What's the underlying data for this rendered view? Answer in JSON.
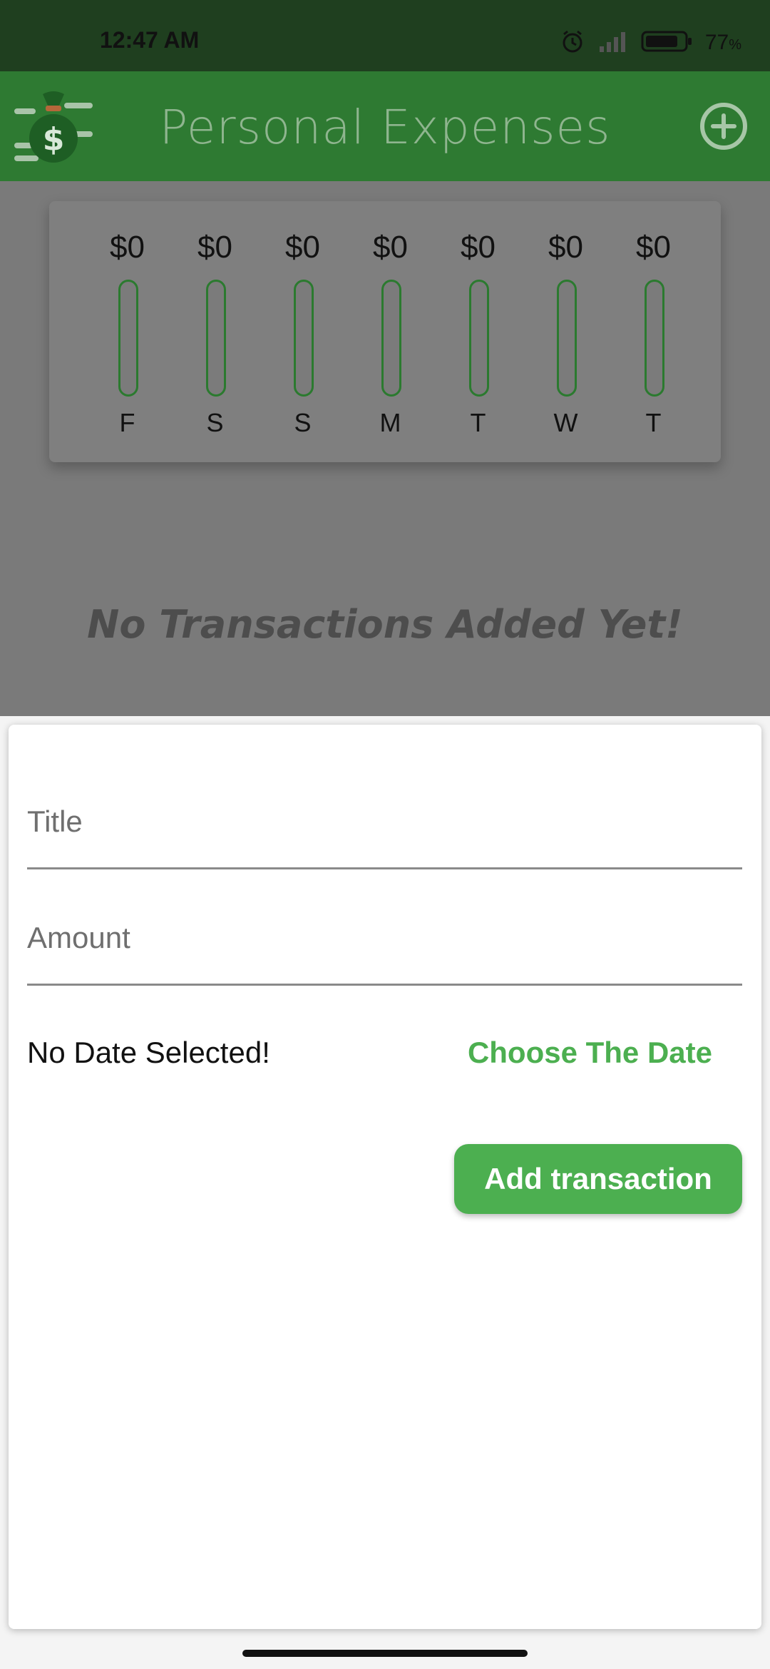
{
  "status_bar": {
    "time": "12:47 AM",
    "battery_percent": "77",
    "battery_unit": "%",
    "icons": [
      "alarm-icon",
      "signal-icon",
      "battery-icon"
    ]
  },
  "app_bar": {
    "title": "Personal Expenses",
    "logo_icon": "money-bag-icon",
    "action_icon": "add-circle-icon"
  },
  "colors": {
    "primary": "#2e7a32",
    "accent": "#4caf50",
    "status_bar": "#1f3f1f",
    "overlay": "#7a7a7a"
  },
  "chart": {
    "bars": [
      {
        "amount": "$0",
        "day": "F",
        "fill": 0
      },
      {
        "amount": "$0",
        "day": "S",
        "fill": 0
      },
      {
        "amount": "$0",
        "day": "S",
        "fill": 0
      },
      {
        "amount": "$0",
        "day": "M",
        "fill": 0
      },
      {
        "amount": "$0",
        "day": "T",
        "fill": 0
      },
      {
        "amount": "$0",
        "day": "W",
        "fill": 0
      },
      {
        "amount": "$0",
        "day": "T",
        "fill": 0
      }
    ]
  },
  "transactions": {
    "empty_message": "No Transactions Added Yet!"
  },
  "form": {
    "title_placeholder": "Title",
    "title_value": "",
    "amount_placeholder": "Amount",
    "amount_value": "",
    "date_text": "No Date Selected!",
    "choose_date_label": "Choose The Date",
    "submit_label": "Add transaction"
  }
}
